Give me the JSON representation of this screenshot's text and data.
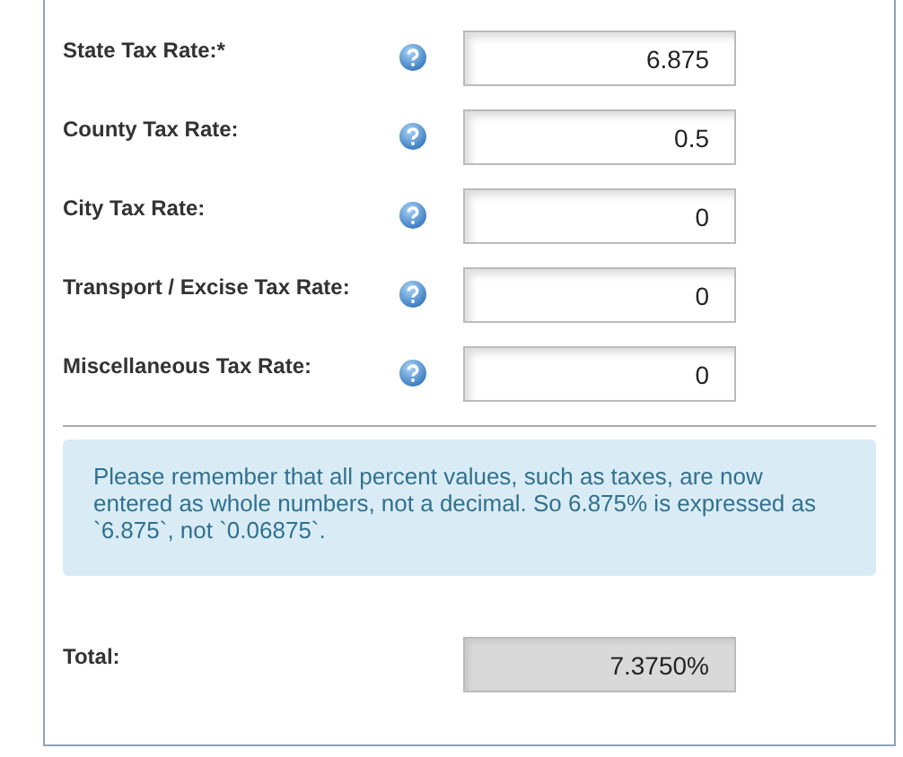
{
  "fields": [
    {
      "label": "State Tax Rate:*",
      "value": "6.875"
    },
    {
      "label": "County Tax Rate:",
      "value": "0.5"
    },
    {
      "label": "City Tax Rate:",
      "value": "0"
    },
    {
      "label": "Transport / Excise Tax Rate:",
      "value": "0"
    },
    {
      "label": "Miscellaneous Tax Rate:",
      "value": "0"
    }
  ],
  "notice": "Please remember that all percent values, such as taxes, are now entered as whole numbers, not a decimal. So 6.875% is expressed as `6.875`, not `0.06875`.",
  "total": {
    "label": "Total:",
    "value": "7.3750%"
  }
}
